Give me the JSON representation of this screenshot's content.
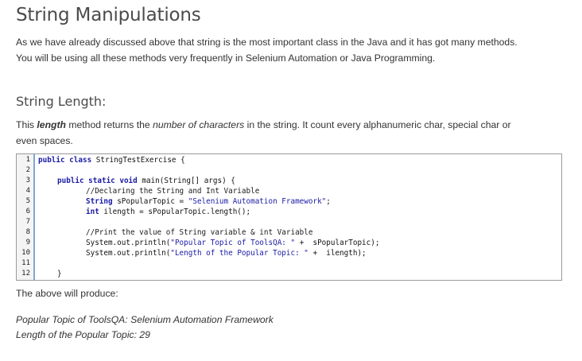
{
  "title": "String Manipulations",
  "intro_line1": "As we have already discussed above that string is the most important class in the Java and it has got many methods.",
  "intro_line2": "You will be using all these methods very frequently in Selenium Automation or Java Programming.",
  "section_title": "String Length:",
  "desc": {
    "prefix": "This ",
    "bold_word": "length",
    "middle": " method returns the ",
    "italic_phrase": "number of characters",
    "rest_line1": " in the string. It count every alphanumeric char, special char or",
    "line2": "even spaces."
  },
  "code": {
    "line_numbers": [
      "1",
      "2",
      "3",
      "4",
      "5",
      "6",
      "7",
      "8",
      "9",
      "10",
      "11",
      "12"
    ],
    "l1_kw": "public class",
    "l1_rest": " StringTestExercise {",
    "l3_kw": "public static void",
    "l3_rest": " main(String[] args) {",
    "l4": "//Declaring the String and Int Variable",
    "l5_kw": "String",
    "l5_rest": " sPopularTopic = ",
    "l5_str": "\"Selenium Automation Framework\"",
    "l5_end": ";",
    "l6_kw": "int",
    "l6_rest": " ilength = sPopularTopic.length();",
    "l8": "//Print the value of String variable & int Variable",
    "l9_a": "System.out.println(",
    "l9_str": "\"Popular Topic of ToolsQA: \"",
    "l9_b": " +  sPopularTopic);",
    "l10_a": "System.out.println(",
    "l10_str": "\"Length of the Popular Topic: \"",
    "l10_b": " +  ilength);",
    "l12": "}"
  },
  "produce_label": "The above will produce:",
  "output_line1": "Popular Topic of ToolsQA: Selenium Automation Framework",
  "output_line2": "Length of the Popular Topic: 29"
}
